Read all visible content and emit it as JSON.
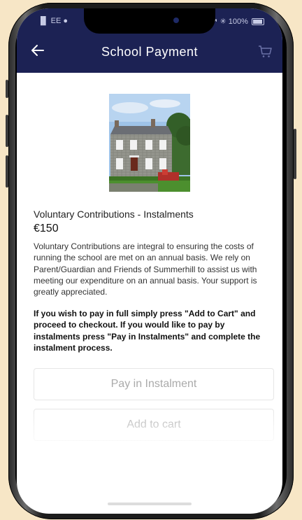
{
  "status_bar": {
    "left": "▐▌ EE ●",
    "right": "↗ ✳ 100%"
  },
  "header": {
    "title": "School Payment"
  },
  "product": {
    "name": "Voluntary Contributions - Instalments",
    "price": "€150",
    "description": "Voluntary Contributions are integral to ensuring the costs of running the school are met on an annual basis. We rely on Parent/Guardian and Friends of Summerhill to assist us with meeting our expenditure on an annual basis. Your support is greatly appreciated.",
    "note": "If you wish to pay in full simply press \"Add to Cart\" and proceed to checkout. If you would like to pay by instalments press \"Pay in Instalments\" and complete the instalment process."
  },
  "buttons": {
    "pay_instalment": "Pay in Instalment",
    "add_to_cart": "Add to cart"
  },
  "colors": {
    "header_bg": "#1c2254",
    "page_bg": "#f7e6c6"
  },
  "icons": {
    "back": "back-arrow-icon",
    "cart": "cart-icon"
  }
}
